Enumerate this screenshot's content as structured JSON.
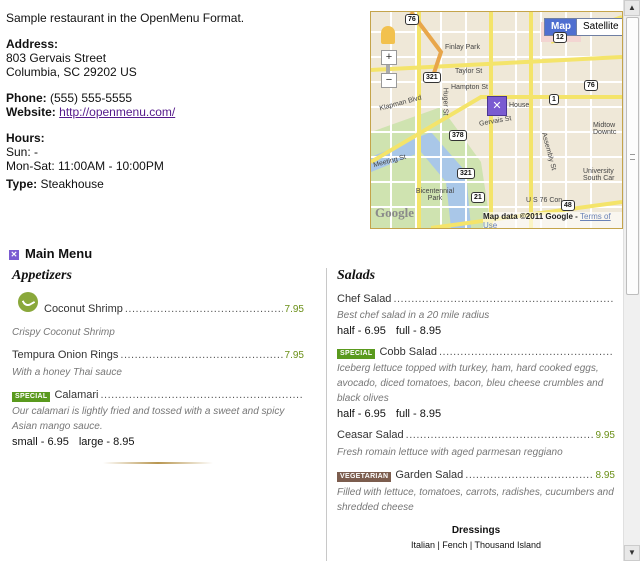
{
  "restaurant": {
    "intro": "Sample restaurant in the OpenMenu Format.",
    "address_label": "Address:",
    "address_line1": "803 Gervais Street",
    "address_line2": "Columbia, SC 29202 US",
    "phone_label": "Phone:",
    "phone": "(555) 555-5555",
    "website_label": "Website:",
    "website": "http://openmenu.com/",
    "hours_label": "Hours:",
    "hours_sun": "Sun: -",
    "hours_mon_sat": "Mon-Sat: 11:00AM - 10:00PM",
    "type_label": "Type:",
    "type": "Steakhouse"
  },
  "map": {
    "map_button": "Map",
    "satellite_button": "Satellite",
    "credit": "Map data ©2011 Google - ",
    "terms": "Terms of Use",
    "google_logo": "Google",
    "labels": {
      "finlay": "Finlay Park",
      "taylor": "Taylor St",
      "hampton": "Hampton St",
      "klapman": "Klapman Blvd",
      "gervais": "Gervais St",
      "huger": "Huger St",
      "meeting": "Meeting St",
      "assembly": "Assembly St",
      "bicentennial": "Bicentennial Park",
      "house": "House",
      "midtown": "Midtow Downtc",
      "university": "University South Car",
      "us76": "U S 76 Con"
    },
    "shields": [
      "76",
      "12",
      "321",
      "1",
      "76",
      "378",
      "321",
      "21",
      "48"
    ]
  },
  "menu": {
    "title": "Main Menu",
    "appetizers": {
      "title": "Appetizers",
      "items": [
        {
          "name": "Coconut Shrimp",
          "price": "7.95",
          "desc": "Crispy Coconut Shrimp"
        },
        {
          "name": "Tempura Onion Rings",
          "price": "7.95",
          "desc": "With a honey Thai sauce"
        },
        {
          "badge": "SPECIAL",
          "name": "Calamari",
          "desc": "Our calamari is lightly fried and tossed with a sweet and spicy Asian mango sauce.",
          "size1": "small - 6.95",
          "size2": "large - 8.95"
        }
      ]
    },
    "salads": {
      "title": "Salads",
      "items": [
        {
          "name": "Chef Salad",
          "desc": "Best chef salad in a 20 mile radius",
          "size1": "half - 6.95",
          "size2": "full - 8.95"
        },
        {
          "badge": "SPECIAL",
          "name": "Cobb Salad",
          "desc": "Iceberg lettuce topped with turkey, ham, hard cooked eggs, avocado, diced tomatoes, bacon, bleu cheese crumbles and black olives",
          "size1": "half - 6.95",
          "size2": "full - 8.95"
        },
        {
          "name": "Ceasar Salad",
          "price": "9.95",
          "desc": "Fresh romain lettuce with aged parmesan reggiano"
        },
        {
          "badge": "VEGETARIAN",
          "name": "Garden Salad",
          "price": "8.95",
          "desc": "Filled with lettuce, tomatoes, carrots, radishes, cucumbers and shredded cheese"
        }
      ],
      "dressings_title": "Dressings",
      "dressings": "Italian | Fench | Thousand Island"
    }
  },
  "colors": {
    "price": "#6a8f17",
    "special": "#5a9a1e",
    "vegetarian": "#7c5d4e",
    "map_border": "#c4a44b"
  }
}
